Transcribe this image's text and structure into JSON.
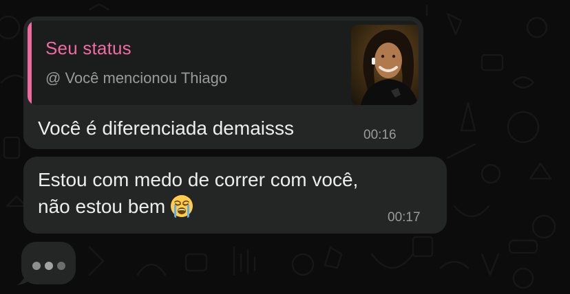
{
  "theme": {
    "background": "#0c0c0c",
    "bubble": "#242626",
    "quote_bg": "#1b1d1d",
    "accent_pink": "#f06ba1",
    "text": "#ededed",
    "muted": "#9a9a9a"
  },
  "messages": [
    {
      "reply": {
        "title": "Seu status",
        "subtitle": "@ Você mencionou Thiago",
        "thumbnail": "status-photo"
      },
      "text": "Você é diferenciada demaisss",
      "time": "00:16"
    },
    {
      "text_line1": "Estou com medo de correr com você,",
      "text_line2": "não estou bem",
      "emoji": "loudly-crying-face",
      "time": "00:17"
    }
  ],
  "typing_indicator": {
    "dots": 3
  }
}
